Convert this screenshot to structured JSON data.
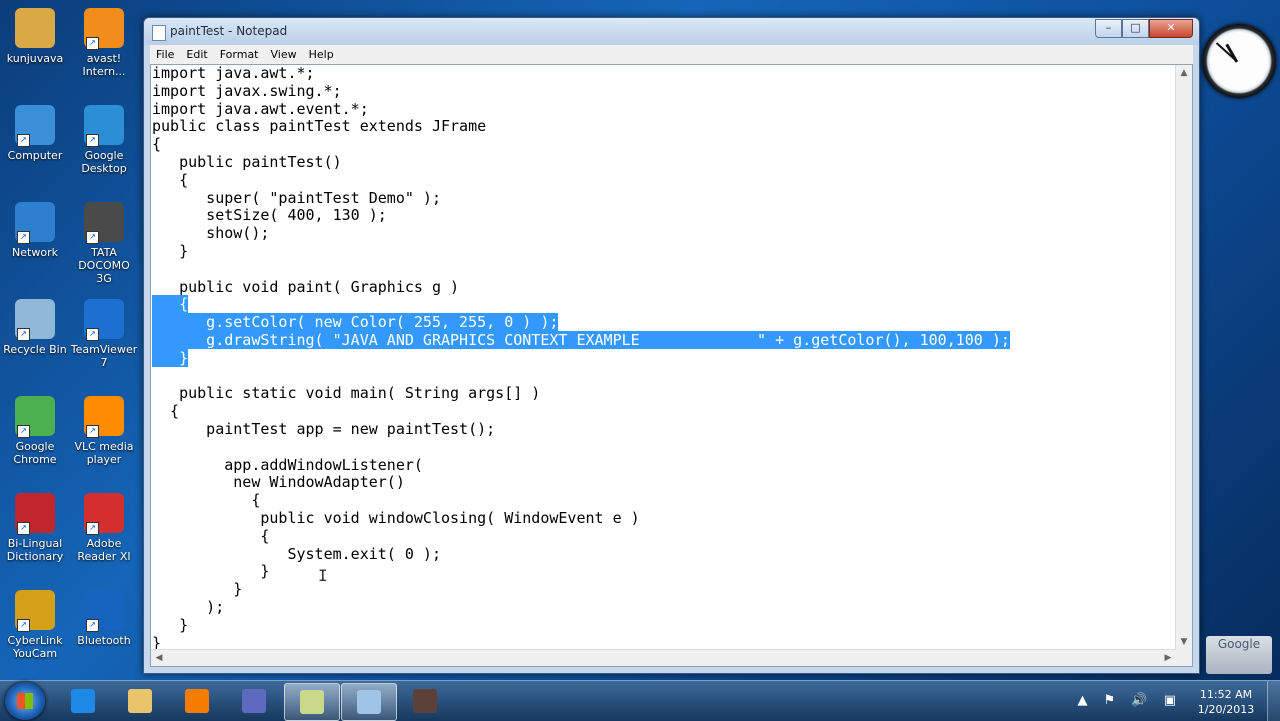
{
  "desktop": {
    "icons": [
      {
        "label": "kunjuvava",
        "color": "#d8a944"
      },
      {
        "label": "avast! Intern...",
        "color": "#f28c1a"
      },
      {
        "label": "Computer",
        "color": "#3b8ed8"
      },
      {
        "label": "Google Desktop",
        "color": "#2c8fd6"
      },
      {
        "label": "Network",
        "color": "#2e7fcf"
      },
      {
        "label": "TATA DOCOMO 3G",
        "color": "#4a4a4a"
      },
      {
        "label": "Recycle Bin",
        "color": "#8fb8d8"
      },
      {
        "label": "TeamViewer 7",
        "color": "#1d6fd1"
      },
      {
        "label": "Google Chrome",
        "color": "#4caf50"
      },
      {
        "label": "VLC media player",
        "color": "#ff8c00"
      },
      {
        "label": "Bi-Lingual Dictionary",
        "color": "#c0272d"
      },
      {
        "label": "Adobe Reader XI",
        "color": "#d32f2f"
      },
      {
        "label": "CyberLink YouCam",
        "color": "#d4a017"
      },
      {
        "label": "Bluetooth",
        "color": "#1565c0"
      }
    ]
  },
  "window": {
    "title": "paintTest - Notepad",
    "buttons": {
      "minimize": "–",
      "maximize": "□",
      "close": "✕"
    },
    "menu": [
      "File",
      "Edit",
      "Format",
      "View",
      "Help"
    ]
  },
  "code_lines": [
    {
      "text": "import java.awt.*;",
      "selected": false
    },
    {
      "text": "import javax.swing.*;",
      "selected": false
    },
    {
      "text": "import java.awt.event.*;",
      "selected": false
    },
    {
      "text": "public class paintTest extends JFrame",
      "selected": false
    },
    {
      "text": "{",
      "selected": false
    },
    {
      "text": "   public paintTest()",
      "selected": false
    },
    {
      "text": "   {",
      "selected": false
    },
    {
      "text": "      super( \"paintTest Demo\" );",
      "selected": false
    },
    {
      "text": "      setSize( 400, 130 );",
      "selected": false
    },
    {
      "text": "      show();",
      "selected": false
    },
    {
      "text": "   }",
      "selected": false
    },
    {
      "text": "",
      "selected": false
    },
    {
      "text": "   public void paint( Graphics g )",
      "selected": false
    },
    {
      "text": "   {",
      "selected": true
    },
    {
      "text": "      g.setColor( new Color( 255, 255, 0 ) );",
      "selected": true
    },
    {
      "text": "      g.drawString( \"JAVA AND GRAPHICS CONTEXT EXAMPLE             \" + g.getColor(), 100,100 );",
      "selected": true
    },
    {
      "text": "   }",
      "selected": true
    },
    {
      "text": "",
      "selected": false
    },
    {
      "text": "   public static void main( String args[] )",
      "selected": false
    },
    {
      "text": "  {",
      "selected": false
    },
    {
      "text": "      paintTest app = new paintTest();",
      "selected": false
    },
    {
      "text": "",
      "selected": false
    },
    {
      "text": "        app.addWindowListener(",
      "selected": false
    },
    {
      "text": "         new WindowAdapter()",
      "selected": false
    },
    {
      "text": "           {",
      "selected": false
    },
    {
      "text": "            public void windowClosing( WindowEvent e )",
      "selected": false
    },
    {
      "text": "            {",
      "selected": false
    },
    {
      "text": "               System.exit( 0 );",
      "selected": false
    },
    {
      "text": "            }",
      "selected": false
    },
    {
      "text": "         }",
      "selected": false
    },
    {
      "text": "      );",
      "selected": false
    },
    {
      "text": "   }",
      "selected": false
    },
    {
      "text": "}",
      "selected": false
    }
  ],
  "gadgets": {
    "google_label": "Google"
  },
  "taskbar": {
    "items": [
      {
        "name": "internet-explorer",
        "color": "#1e88e5",
        "active": false
      },
      {
        "name": "file-explorer",
        "color": "#e8c56a",
        "active": false
      },
      {
        "name": "media-player",
        "color": "#f57c00",
        "active": false
      },
      {
        "name": "app-infinity",
        "color": "#5c6bc0",
        "active": false
      },
      {
        "name": "notes",
        "color": "#c9d88a",
        "active": true
      },
      {
        "name": "notepad",
        "color": "#9fc4e8",
        "active": true
      },
      {
        "name": "video-camera",
        "color": "#5d4037",
        "active": false
      }
    ],
    "tray_icons": "▲ ⚑ 🔊 ▣",
    "time": "11:52 AM",
    "date": "1/20/2013"
  }
}
